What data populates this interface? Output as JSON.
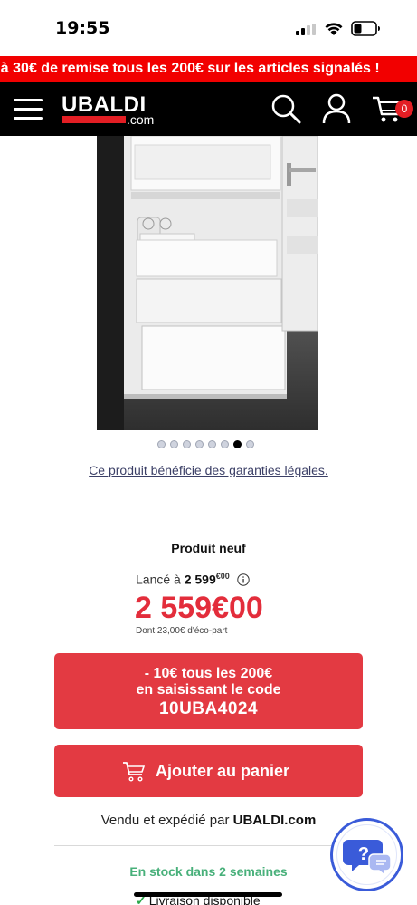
{
  "status": {
    "time": "19:55"
  },
  "promo_banner": {
    "text": "'à 30€ de remise tous les 200€ sur les articles signalés !"
  },
  "header": {
    "logo_text": "UBALDI",
    "logo_suffix": ".com",
    "cart_count": "0"
  },
  "gallery": {
    "dot_count": 8,
    "active_index": 6
  },
  "guarantee_link": "Ce produit bénéficie des garanties légales.",
  "product": {
    "condition": "Produit neuf",
    "launched_label": "Lancé à ",
    "launched_price": "2 599",
    "launched_cents": "€00",
    "price_main": "2 559",
    "price_cents": "€00",
    "eco_part": "Dont 23,00€ d'éco-part"
  },
  "promo_code": {
    "line1": "- 10€ tous les 200€",
    "line2": "en saisissant le code",
    "code": "10UBA4024"
  },
  "add_to_cart_label": "Ajouter au panier",
  "sold_by": {
    "prefix": "Vendu et expédié par ",
    "seller": "UBALDI.com"
  },
  "stock_text": "En stock dans 2 semaines",
  "delivery_text": "Livraison disponible",
  "colors": {
    "brand_red": "#e31e24",
    "button_red": "#e33a42",
    "price_red": "#e32d3b",
    "stock_green": "#48b07a",
    "help_blue": "#3a5bd9"
  }
}
